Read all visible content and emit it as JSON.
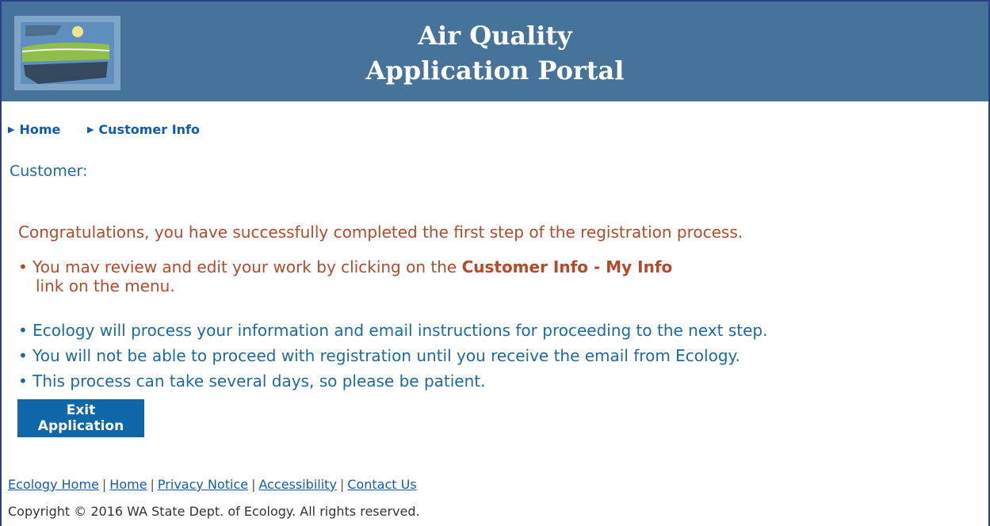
{
  "header": {
    "title_line1": "Air Quality",
    "title_line2": "Application Portal"
  },
  "nav": {
    "home": "Home",
    "customer_info": "Customer Info"
  },
  "customer_label": "Customer:",
  "congrats": "Congratulations, you have successfully completed the first step of the registration process.",
  "bullets": {
    "b1_pre": "You mav review and edit your work by clicking on the ",
    "b1_bold": "Customer Info - My Info",
    "b1_post": "link on the menu.",
    "b2": "Ecology will process your information and email instructions for proceeding to the next step.",
    "b3": "You will not be able to proceed with registration until you receive the email from Ecology.",
    "b4": "This process can take several days, so please be patient."
  },
  "exit_button": {
    "line1": "Exit",
    "line2": "Application"
  },
  "footer": {
    "links": [
      "Ecology Home",
      "Home",
      "Privacy Notice",
      "Accessibility",
      "Contact Us"
    ],
    "copyright": "Copyright © 2016 WA State Dept. of Ecology. All rights reserved."
  },
  "colors": {
    "header_bg": "#457399",
    "accent_orange": "#b54a2a",
    "accent_blue": "#1c6aa2",
    "link": "#0f5db0",
    "button_bg": "#0e67a8"
  }
}
